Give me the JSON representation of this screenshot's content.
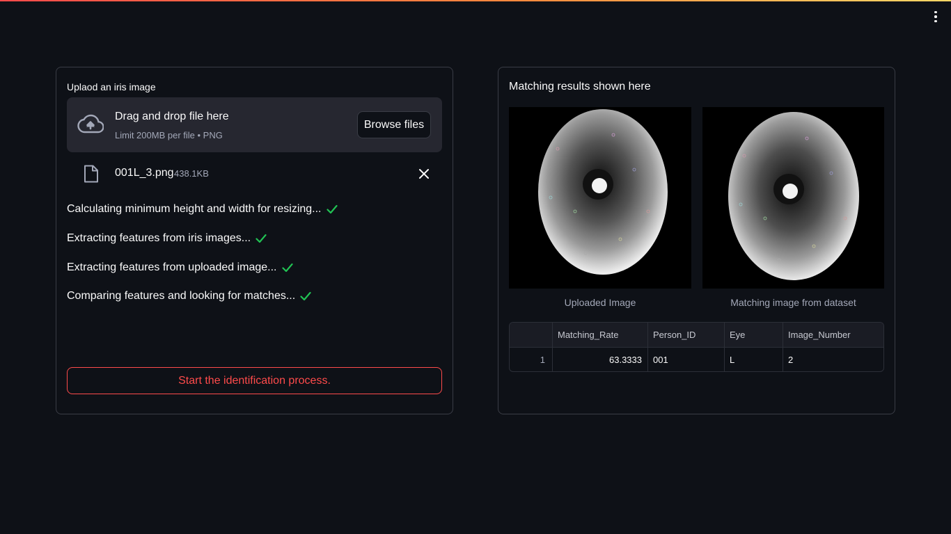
{
  "uploader": {
    "label": "Uplaod an iris image",
    "dropzone_title": "Drag and drop file here",
    "dropzone_subtitle": "Limit 200MB per file • PNG",
    "browse_label": "Browse files",
    "file_name": "001L_3.png",
    "file_size": "438.1KB"
  },
  "status_lines": [
    "Calculating minimum height and width for resizing...",
    "Extracting features from iris images...",
    "Extracting features from uploaded image...",
    "Comparing features and looking for matches..."
  ],
  "start_button_label": "Start the identification process.",
  "results": {
    "title": "Matching results shown here",
    "caption_uploaded": "Uploaded Image",
    "caption_match": "Matching image from dataset",
    "table": {
      "columns": [
        "",
        "Matching_Rate",
        "Person_ID",
        "Eye",
        "Image_Number"
      ],
      "rows": [
        [
          "1",
          "63.3333",
          "001",
          "L",
          "2"
        ]
      ]
    }
  },
  "colors": {
    "background": "#0e1117",
    "accent": "#ff4b4b",
    "success": "#21c354",
    "panel": "#262730"
  },
  "icons": {
    "menu": "vertical-dots-icon",
    "upload": "cloud-upload-icon",
    "file": "file-icon",
    "remove": "close-icon",
    "done": "check-icon"
  }
}
